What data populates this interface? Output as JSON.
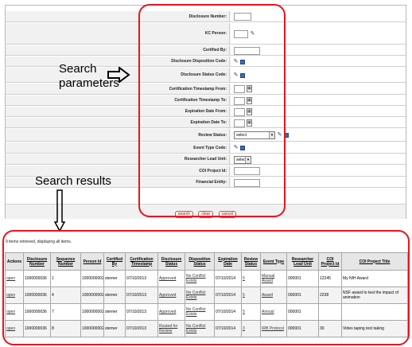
{
  "form": {
    "fields": [
      {
        "label": "Disclosure Number:",
        "control": "text"
      },
      {
        "label": "KC Person:",
        "control": "text-lookup"
      },
      {
        "label": "Certified By:",
        "control": "text"
      },
      {
        "label": "Disclosure Disposition Code:",
        "control": "lookup-dir"
      },
      {
        "label": "Disclosure Status Code:",
        "control": "lookup-dir"
      },
      {
        "label": "Certification Timestamp From:",
        "control": "date"
      },
      {
        "label": "Certification Timestamp To:",
        "control": "date"
      },
      {
        "label": "Expiration Date From:",
        "control": "date"
      },
      {
        "label": "Expiration Date To:",
        "control": "date"
      },
      {
        "label": "Review Status:",
        "control": "select-lookup",
        "value": "select"
      },
      {
        "label": "Event Type Code:",
        "control": "lookup-dir"
      },
      {
        "label": "Researcher Lead Unit:",
        "control": "select-small",
        "value": "select"
      },
      {
        "label": "COI Project Id:",
        "control": "text"
      },
      {
        "label": "Financial Entity:",
        "control": "text"
      }
    ],
    "buttons": {
      "search": "search",
      "clear": "clear",
      "cancel": "cancel"
    }
  },
  "annotations": {
    "search_parameters": "Search parameters",
    "search_results": "Search results"
  },
  "results": {
    "summary": "9 items retrieved, displaying all items.",
    "columns": [
      "Actions",
      "Disclosure Number",
      "Sequence Number",
      "Person Id",
      "Certified By",
      "Certification Timestamp",
      "Disclosure Status",
      "Disposition Status",
      "Expiration Date",
      "Review Status",
      "Event Type",
      "Researcher Lead Unit",
      "COI Project Id",
      "COI Project Title"
    ],
    "rows": [
      [
        "open",
        "1000000036",
        "1",
        "10000000025",
        "sterner",
        "07/10/2013",
        "Approved",
        "No Conflict Exists",
        "07/10/2014",
        "5",
        "Manual Award",
        "000001",
        "12245",
        "My NIH Award"
      ],
      [
        "open",
        "1000000036",
        "4",
        "10000000025",
        "sterner",
        "07/10/2013",
        "Approved",
        "No Conflict Exists",
        "07/10/2014",
        "5",
        "Award",
        "000001",
        "2238",
        "NSF award to test the impact of animation"
      ],
      [
        "open",
        "1000000036",
        "7",
        "10000000025",
        "sterner",
        "07/10/2013",
        "Approved",
        "No Conflict Exists",
        "07/10/2014",
        "5",
        "Annual",
        "000001",
        "",
        ""
      ],
      [
        "open",
        "1000000036",
        "8",
        "10000000025",
        "sterner",
        "07/10/2013",
        "Routed for Review",
        "No Conflict Exists",
        "07/10/2014",
        "3",
        "IRB Protocol",
        "000001",
        "30",
        "Video taping test taking"
      ]
    ]
  },
  "colors": {
    "highlight": "#e8141e",
    "label_bg": "#f1f1f1"
  },
  "icons": [
    "search-lookup-icon",
    "directory-icon",
    "calendar-icon",
    "arrow-right-icon",
    "arrow-down-icon"
  ]
}
